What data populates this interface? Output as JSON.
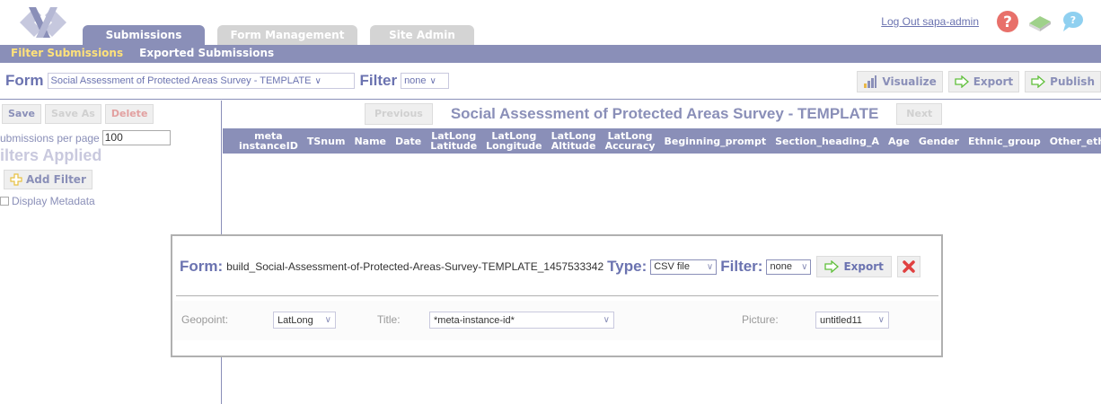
{
  "header": {
    "tabs": [
      {
        "label": "Submissions"
      },
      {
        "label": "Form Management"
      },
      {
        "label": "Site Admin"
      }
    ],
    "logout": "Log Out sapa-admin",
    "icons": [
      "help-icon",
      "book-icon",
      "feedback-icon"
    ]
  },
  "subnav": {
    "items": [
      {
        "label": "Filter Submissions"
      },
      {
        "label": "Exported Submissions"
      }
    ]
  },
  "formbar": {
    "form_label": "Form",
    "form_value": "Social Assessment of Protected Areas Survey - TEMPLATE",
    "filter_label": "Filter",
    "filter_value": "none",
    "visualize": "Visualize",
    "export": "Export",
    "publish": "Publish"
  },
  "sidebar": {
    "save": "Save",
    "save_as": "Save As",
    "delete": "Delete",
    "per_page_label": "ubmissions per page",
    "per_page_value": "100",
    "filters_applied": "ilters Applied",
    "add_filter": "Add Filter",
    "display_metadata": "Display Metadata"
  },
  "table": {
    "previous": "Previous",
    "title": "Social Assessment of Protected Areas Survey - TEMPLATE",
    "next": "Next",
    "columns": [
      {
        "l1": "meta",
        "l2": "instanceID"
      },
      {
        "l1": "TSnum",
        "l2": ""
      },
      {
        "l1": "Name",
        "l2": ""
      },
      {
        "l1": "Date",
        "l2": ""
      },
      {
        "l1": "LatLong",
        "l2": "Latitude"
      },
      {
        "l1": "LatLong",
        "l2": "Longitude"
      },
      {
        "l1": "LatLong",
        "l2": "Altitude"
      },
      {
        "l1": "LatLong",
        "l2": "Accuracy"
      },
      {
        "l1": "Beginning_prompt",
        "l2": ""
      },
      {
        "l1": "Section_heading_A",
        "l2": ""
      },
      {
        "l1": "Age",
        "l2": ""
      },
      {
        "l1": "Gender",
        "l2": ""
      },
      {
        "l1": "Ethnic_group",
        "l2": ""
      },
      {
        "l1": "Other_ethnic",
        "l2": ""
      }
    ]
  },
  "dialog": {
    "form_label": "Form:",
    "form_value": "build_Social-Assessment-of-Protected-Areas-Survey-TEMPLATE_1457533342",
    "type_label": "Type:",
    "type_value": "CSV file",
    "filter_label": "Filter:",
    "filter_value": "none",
    "export": "Export",
    "geopoint_label": "Geopoint:",
    "geopoint_value": "LatLong",
    "title_label": "Title:",
    "title_value": "*meta-instance-id*",
    "picture_label": "Picture:",
    "picture_value": "untitled11"
  }
}
